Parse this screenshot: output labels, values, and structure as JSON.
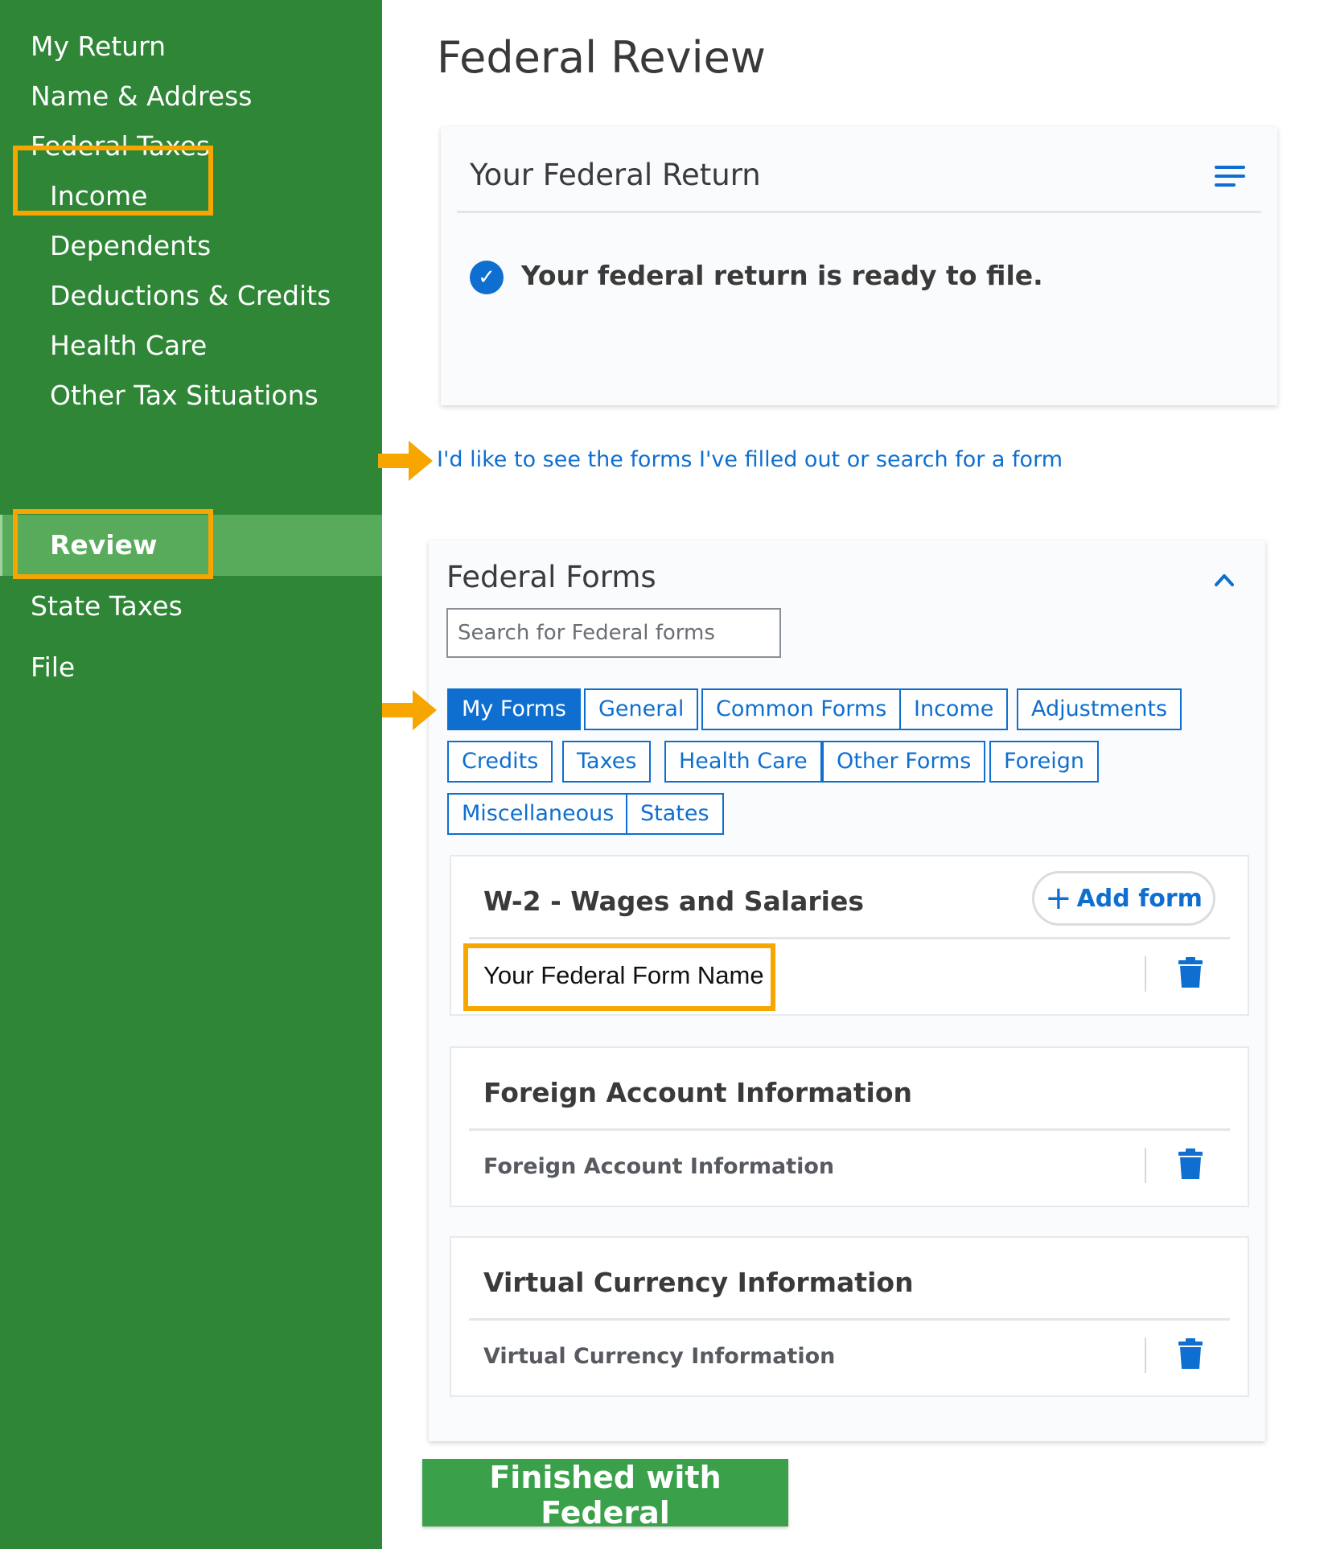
{
  "sidebar": {
    "items": [
      {
        "label": "My Return"
      },
      {
        "label": "Name & Address"
      },
      {
        "label": "Federal Taxes"
      },
      {
        "label": "Income"
      },
      {
        "label": "Dependents"
      },
      {
        "label": "Deductions & Credits"
      },
      {
        "label": "Health Care"
      },
      {
        "label": "Other Tax Situations"
      },
      {
        "label": "Review"
      },
      {
        "label": "State Taxes"
      },
      {
        "label": "File"
      }
    ],
    "active_item": "Review",
    "background": "#2e8636",
    "active_background": "#58ab5a"
  },
  "page": {
    "title": "Federal Review"
  },
  "return_card": {
    "title": "Your Federal Return",
    "status": "Your federal return is ready to file.",
    "menu_icon": "hamburger-menu-icon",
    "status_icon": "check-circle-icon"
  },
  "forms_link": "I'd like to see the forms I've filled out or search for a form",
  "forms_card": {
    "title": "Federal Forms",
    "search_placeholder": "Search for Federal forms",
    "tabs": [
      {
        "label": "My Forms",
        "selected": true
      },
      {
        "label": "General"
      },
      {
        "label": "Common Forms"
      },
      {
        "label": "Income"
      },
      {
        "label": "Adjustments"
      },
      {
        "label": "Credits"
      },
      {
        "label": "Taxes"
      },
      {
        "label": "Health Care"
      },
      {
        "label": "Other Forms"
      },
      {
        "label": "Foreign"
      },
      {
        "label": "Miscellaneous"
      },
      {
        "label": "States"
      }
    ],
    "sections": [
      {
        "title": "W-2 - Wages and Salaries",
        "add_label": "Add form",
        "row": "Your Federal Form Name"
      },
      {
        "title": "Foreign Account Information",
        "row": "Foreign Account Information"
      },
      {
        "title": "Virtual Currency Information",
        "row": "Virtual Currency Information"
      }
    ]
  },
  "finish_button": "Finished with Federal",
  "colors": {
    "accent_blue": "#0f6fd0",
    "highlight": "#f7a600",
    "finish_green": "#3aa14a"
  }
}
